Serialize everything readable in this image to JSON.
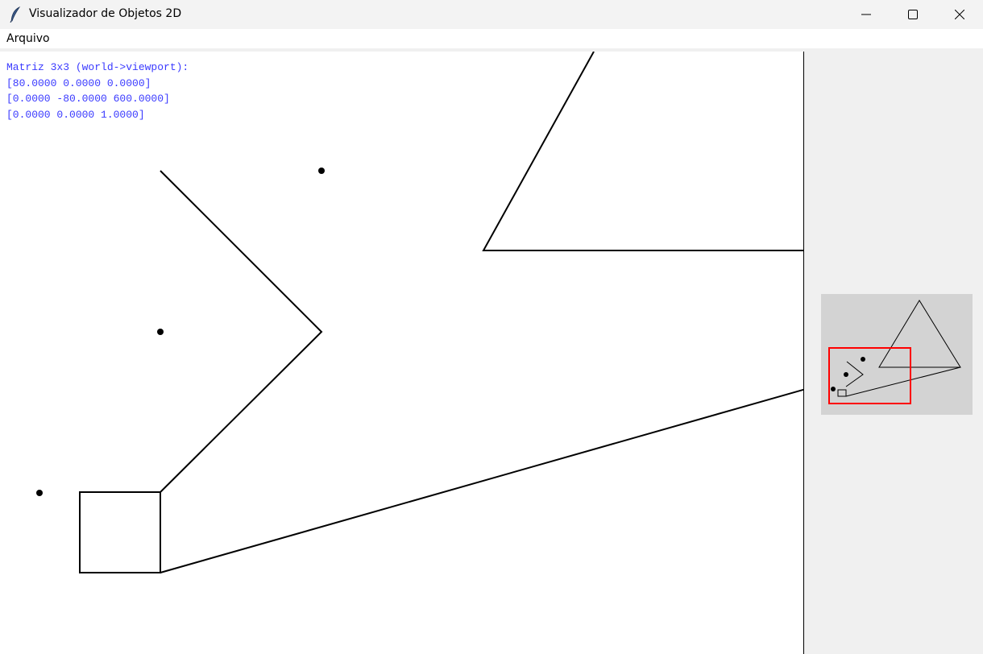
{
  "window": {
    "title": "Visualizador de Objetos 2D",
    "app_icon": "feather-icon",
    "controls": [
      "minimize-icon",
      "maximize-icon",
      "close-icon"
    ]
  },
  "menu": {
    "items": [
      {
        "label": "Arquivo"
      }
    ]
  },
  "matrix": {
    "title": "Matriz 3x3 (world->viewport):",
    "rows": [
      "[80.0000 0.0000 0.0000]",
      "[0.0000 -80.0000 600.0000]",
      "[0.0000 0.0000 1.0000]"
    ]
  },
  "colors": {
    "matrix_text": "#3a3aff",
    "canvas_bg": "#ffffff",
    "minimap_bg": "#d3d3d3",
    "minimap_viewport": "#ff0000",
    "stroke": "#000000"
  }
}
